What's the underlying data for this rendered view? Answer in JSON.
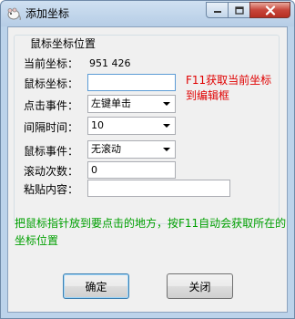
{
  "window": {
    "title": "添加坐标"
  },
  "group": {
    "legend": "鼠标坐标位置",
    "current_coord_label": "当前坐标：",
    "current_coord_value": "951  426",
    "mouse_coord_label": "鼠标坐标：",
    "mouse_coord_value": "",
    "click_event_label": "点击事件：",
    "click_event_value": "左键单击",
    "interval_label": "间隔时间：",
    "interval_value": "10",
    "mouse_event_label": "鼠标事件：",
    "mouse_event_value": "无滚动",
    "scroll_count_label": "滚动次数：",
    "scroll_count_value": "0",
    "paste_label": "粘贴内容：",
    "paste_value": ""
  },
  "hints": {
    "f11_line1": "F11获取当前坐标",
    "f11_line2": "到编辑框",
    "instruction_line1": "把鼠标指针放到要点击的地方，按F11自动会获取所在的",
    "instruction_line2": "坐标位置"
  },
  "buttons": {
    "ok": "确定",
    "close": "关闭"
  },
  "colors": {
    "hint_red": "#e00000",
    "hint_green": "#00a000"
  },
  "icons": {
    "app": "mouse-icon",
    "minimize": "minimize-icon",
    "maximize": "maximize-icon",
    "close": "close-icon"
  }
}
